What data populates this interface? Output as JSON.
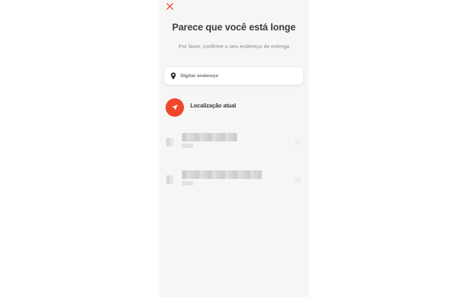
{
  "header": {
    "close_icon": "close-icon",
    "title": "Parece que você está longe",
    "subtitle": "Por favor, confirme o seu endereço de entrega"
  },
  "search": {
    "placeholder": "Digitar endereço",
    "icon": "map-pin-icon"
  },
  "current_location": {
    "label": "Localização atual",
    "icon": "navigation-arrow-icon"
  },
  "colors": {
    "accent": "#f0462b",
    "background": "#f6f6f6"
  }
}
